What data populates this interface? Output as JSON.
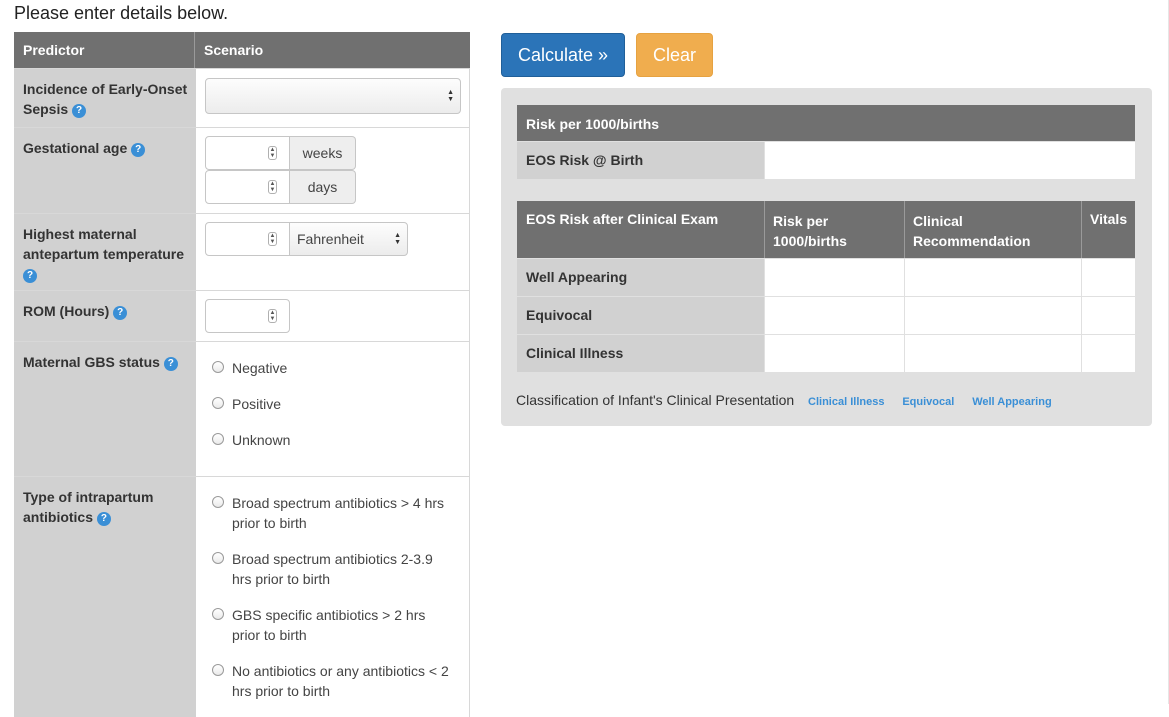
{
  "heading": "Please enter details below.",
  "form": {
    "col_predictor": "Predictor",
    "col_scenario": "Scenario",
    "incidence": {
      "label": "Incidence of Early-Onset Sepsis",
      "selected": ""
    },
    "gestational_age": {
      "label": "Gestational age",
      "unit_weeks": "weeks",
      "unit_days": "days"
    },
    "temperature": {
      "label": "Highest maternal antepartum temperature",
      "unit_selected": "Fahrenheit"
    },
    "rom": {
      "label": "ROM (Hours)"
    },
    "gbs": {
      "label": "Maternal GBS status",
      "options": [
        "Negative",
        "Positive",
        "Unknown"
      ]
    },
    "antibiotics": {
      "label": "Type of intrapartum antibiotics",
      "options": [
        "Broad spectrum antibiotics > 4 hrs prior to birth",
        "Broad spectrum antibiotics 2-3.9 hrs prior to birth",
        "GBS specific antibiotics > 2 hrs prior to birth",
        "No antibiotics or any antibiotics < 2 hrs prior to birth"
      ]
    },
    "help_glyph": "?"
  },
  "buttons": {
    "calculate": "Calculate »",
    "clear": "Clear"
  },
  "results": {
    "birth_table": {
      "header": "Risk per 1000/births",
      "row_label": "EOS Risk @ Birth",
      "value": ""
    },
    "exam_table": {
      "headers": [
        "EOS Risk after Clinical Exam",
        "Risk per 1000/births",
        "Clinical Recommendation",
        "Vitals"
      ],
      "rows": [
        "Well Appearing",
        "Equivocal",
        "Clinical Illness"
      ]
    },
    "classification_label": "Classification of Infant's Clinical Presentation",
    "badges": [
      "Clinical Illness",
      "Equivocal",
      "Well Appearing"
    ]
  },
  "colors": {
    "primary": "#2b74b8",
    "warning": "#f0ad4e",
    "header_gray": "#707070",
    "label_gray": "#d1d1d1",
    "panel_gray": "#e0e0e0",
    "help_blue": "#3a8fd6"
  }
}
